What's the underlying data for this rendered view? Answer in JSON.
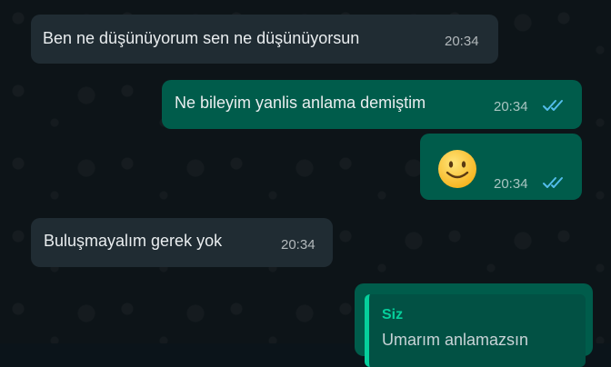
{
  "messages": [
    {
      "text": "Ben ne düşünüyorum sen ne düşünüyorsun",
      "time": "20:34"
    },
    {
      "text": "Ne bileyim yanlis anlama demiştim",
      "time": "20:34",
      "status": "read"
    },
    {
      "emoji": "smiling-face",
      "time": "20:34",
      "status": "read"
    },
    {
      "text": "Buluşmayalım gerek yok",
      "time": "20:34"
    }
  ],
  "reply": {
    "author": "Siz",
    "text": "Umarım anlamazsın"
  },
  "colors": {
    "background": "#0b141a",
    "incoming_bubble": "#202c33",
    "outgoing_bubble": "#005c4b",
    "read_ticks": "#53bdeb",
    "quote_accent": "#06cf9c"
  }
}
